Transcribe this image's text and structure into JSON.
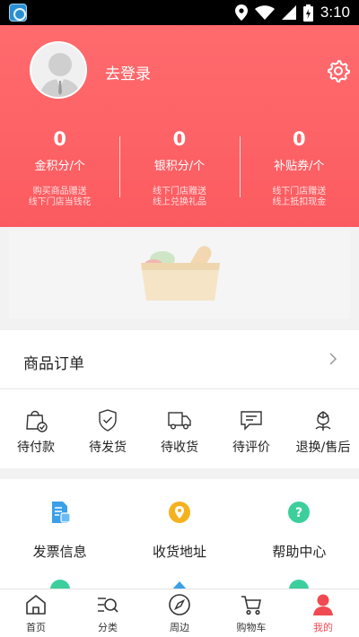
{
  "status_bar": {
    "time": "3:10"
  },
  "header": {
    "login_text": "去登录",
    "stats": [
      {
        "value": "0",
        "label": "金积分/个",
        "desc_line1": "购买商品赠送",
        "desc_line2": "线下门店当钱花"
      },
      {
        "value": "0",
        "label": "银积分/个",
        "desc_line1": "线下门店赠送",
        "desc_line2": "线上兑换礼品"
      },
      {
        "value": "0",
        "label": "补贴券/个",
        "desc_line1": "线下门店赠送",
        "desc_line2": "线上抵扣现金"
      }
    ]
  },
  "orders": {
    "title": "商品订单",
    "statuses": [
      {
        "label": "待付款",
        "icon": "shopping-bag-icon"
      },
      {
        "label": "待发货",
        "icon": "shield-check-icon"
      },
      {
        "label": "待收货",
        "icon": "truck-icon"
      },
      {
        "label": "待评价",
        "icon": "comment-icon"
      },
      {
        "label": "退换/售后",
        "icon": "flower-icon"
      }
    ]
  },
  "services": [
    {
      "label": "发票信息",
      "icon": "invoice-icon",
      "color": "#3aa0e8"
    },
    {
      "label": "收货地址",
      "icon": "location-icon",
      "color": "#f5b21f"
    },
    {
      "label": "帮助中心",
      "icon": "help-icon",
      "color": "#3ccf9c"
    }
  ],
  "tabbar": [
    {
      "label": "首页",
      "icon": "home-icon",
      "active": false
    },
    {
      "label": "分类",
      "icon": "category-search-icon",
      "active": false
    },
    {
      "label": "周边",
      "icon": "compass-icon",
      "active": false
    },
    {
      "label": "购物车",
      "icon": "cart-icon",
      "active": false
    },
    {
      "label": "我的",
      "icon": "user-icon",
      "active": true
    }
  ],
  "colors": {
    "header": "#fb5b60",
    "active_tab": "#f04a52"
  }
}
